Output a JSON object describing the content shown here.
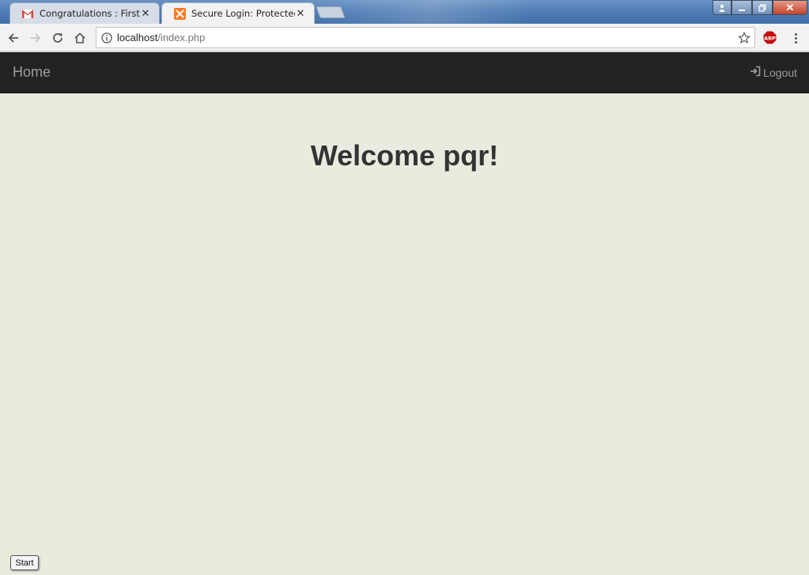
{
  "browser": {
    "tabs": [
      {
        "title": "Congratulations : First Ro",
        "icon": "gmail-icon"
      },
      {
        "title": "Secure Login: Protected P",
        "icon": "xampp-icon"
      }
    ],
    "address": {
      "host": "localhost",
      "path": "/index.php"
    }
  },
  "navbar": {
    "brand": "Home",
    "logout_label": "Logout"
  },
  "main": {
    "welcome": "Welcome pqr!"
  },
  "taskbar": {
    "start_label": "Start"
  },
  "colors": {
    "navbar_bg": "#222222",
    "navbar_text": "#9d9d9d",
    "page_bg": "#ebeade"
  }
}
